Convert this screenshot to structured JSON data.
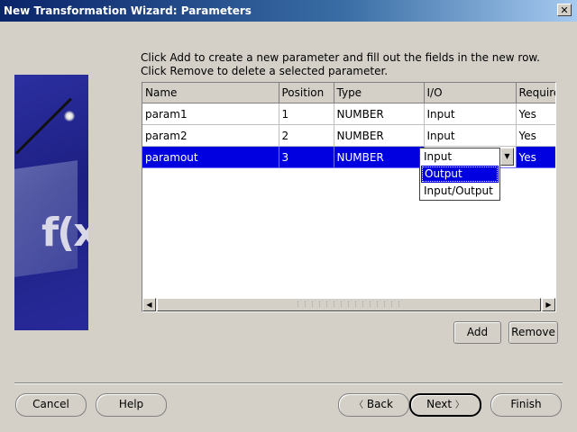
{
  "window": {
    "title": "New Transformation Wizard: Parameters",
    "close_glyph": "✕"
  },
  "instructions": "Click Add to create a new parameter and fill out the fields in the new row. Click Remove to delete a selected parameter.",
  "art": {
    "text": "f(x)"
  },
  "grid": {
    "columns": [
      "Name",
      "Position",
      "Type",
      "I/O",
      "Required"
    ],
    "rows": [
      {
        "name": "param1",
        "position": "1",
        "type": "NUMBER",
        "io": "Input",
        "required": "Yes"
      },
      {
        "name": "param2",
        "position": "2",
        "type": "NUMBER",
        "io": "Input",
        "required": "Yes"
      },
      {
        "name": "paramout",
        "position": "3",
        "type": "NUMBER",
        "io": "",
        "required": "Yes"
      }
    ],
    "selected_row": 2
  },
  "io_dropdown": {
    "options": [
      "Input",
      "Output",
      "Input/Output"
    ],
    "highlighted": 1
  },
  "buttons": {
    "add": "Add",
    "remove": "Remove",
    "cancel": "Cancel",
    "help": "Help",
    "back": "Back",
    "next": "Next",
    "finish": "Finish"
  },
  "colors": {
    "selection": "#0000e0",
    "titlebar": "#0a246a",
    "face": "#d4d0c8"
  }
}
